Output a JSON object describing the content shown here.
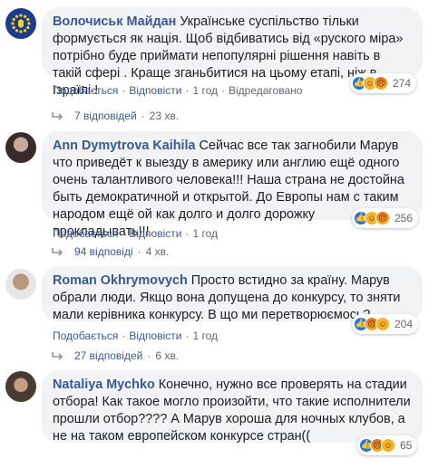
{
  "comments": [
    {
      "author": "Волочиськ Майдан",
      "text": "Українське суспільство тільки формується як нація. Щоб відбиватись від «руского міра» потрібно буде приймати непопулярні рішення навіть в такій сфері . Краще зганьбитися на цьому етапі, ніж в Ізраїлі !",
      "reaction_count": "274",
      "reactions": [
        "like",
        "haha",
        "angry"
      ],
      "actions": [
        "Подобається",
        "Відповісти",
        "1 год",
        "Відредаговано"
      ],
      "replies": {
        "label": "7 відповідей",
        "time": "23 хв."
      }
    },
    {
      "author": "Ann Dymytrova Kaihila",
      "text": "Сейчас все так загнобили Марув что приведёт к выезду в америку или англию ещё одного очень талантливого человека!!! Наша страна не достойна быть демократичной и открытой. До Европы нам с таким народом ещё ой как долго и долго дорожку прокладывать!!!",
      "reaction_count": "256",
      "reactions": [
        "like",
        "haha",
        "angry"
      ],
      "actions": [
        "Подобається",
        "Відповісти",
        "1 год"
      ],
      "replies": {
        "label": "94 відповіді",
        "time": "4 хв."
      }
    },
    {
      "author": "Roman Okhrymovych",
      "text": "Просто встидно за країну. Марув обрали люди. Якщо вона допущена до конкурсу, то зняти мали керівника конкурсу. В що ми перетворюємось?",
      "reaction_count": "204",
      "reactions": [
        "like",
        "angry",
        "haha"
      ],
      "actions": [
        "Подобається",
        "Відповісти",
        "1 год"
      ],
      "replies": {
        "label": "27 відповідей",
        "time": "6 хв."
      }
    },
    {
      "author": "Nataliya Mychko",
      "text": "Конечно, нужно все проверять на стадии отбора! Как такое могло произойти, что такие исполнители прошли отбор???? А Марув хороша для ночных клубов, а не на таком европейском конкурсе стран((",
      "reaction_count": "65",
      "reactions": [
        "like",
        "angry",
        "haha"
      ]
    }
  ],
  "icons": {
    "like": "thumbs-up-icon",
    "haha": "laughing-face-icon",
    "angry": "angry-face-icon",
    "reply": "reply-arrow-icon"
  },
  "colors": {
    "author": "#385898",
    "bubble": "#f2f3f5",
    "meta": "#606770",
    "like": "#1877f2"
  }
}
